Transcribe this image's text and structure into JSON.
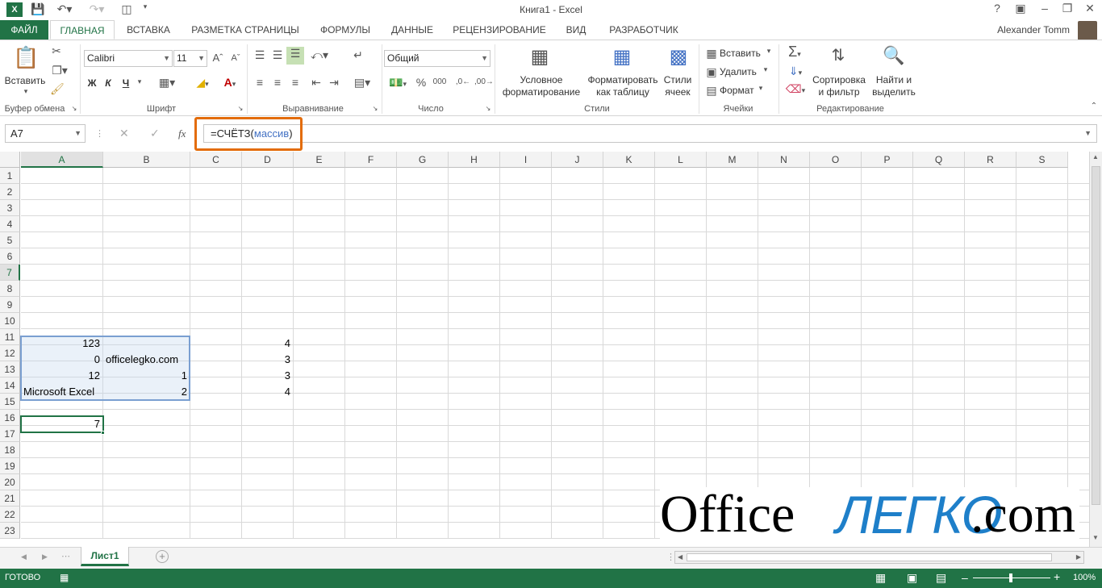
{
  "window": {
    "title": "Книга1 - Excel",
    "user": "Alexander Tomm"
  },
  "tabs": [
    {
      "label": "ФАЙЛ"
    },
    {
      "label": "ГЛАВНАЯ"
    },
    {
      "label": "ВСТАВКА"
    },
    {
      "label": "РАЗМЕТКА СТРАНИЦЫ"
    },
    {
      "label": "ФОРМУЛЫ"
    },
    {
      "label": "ДАННЫЕ"
    },
    {
      "label": "РЕЦЕНЗИРОВАНИЕ"
    },
    {
      "label": "ВИД"
    },
    {
      "label": "РАЗРАБОТЧИК"
    }
  ],
  "ribbon": {
    "paste": "Вставить",
    "font_name": "Calibri",
    "font_size": "11",
    "number_format": "Общий",
    "conditional_1": "Условное",
    "conditional_2": "форматирование",
    "format_table_1": "Форматировать",
    "format_table_2": "как таблицу",
    "cell_styles_1": "Стили",
    "cell_styles_2": "ячеек",
    "insert": "Вставить",
    "delete": "Удалить",
    "format": "Формат",
    "sort_1": "Сортировка",
    "sort_2": "и фильтр",
    "find_1": "Найти и",
    "find_2": "выделить",
    "bold": "Ж",
    "italic": "К",
    "underline": "Ч",
    "groups": {
      "clipboard": "Буфер обмена",
      "font": "Шрифт",
      "alignment": "Выравнивание",
      "number": "Число",
      "styles": "Стили",
      "cells": "Ячейки",
      "editing": "Редактирование"
    }
  },
  "formula_bar": {
    "name_box": "A7",
    "fx": "fx",
    "formula_prefix": "=СЧЁТЗ(",
    "formula_arg": "массив",
    "formula_suffix": ")"
  },
  "columns": [
    "A",
    "B",
    "C",
    "D",
    "E",
    "F",
    "G",
    "H",
    "I",
    "J",
    "K",
    "L",
    "M",
    "N",
    "O",
    "P",
    "Q",
    "R",
    "S"
  ],
  "rows": [
    "1",
    "2",
    "3",
    "4",
    "5",
    "6",
    "7",
    "8",
    "9",
    "10",
    "11",
    "12",
    "13",
    "14",
    "15",
    "16",
    "17",
    "18",
    "19",
    "20",
    "21",
    "22",
    "23"
  ],
  "cells": {
    "A2": "123",
    "A3": "0",
    "A4": "12",
    "A5": "Microsoft Excel",
    "A7": "7",
    "B3": "officelegko.com",
    "B4": "1",
    "B5": "2",
    "D2": "4",
    "D3": "3",
    "D4": "3",
    "D5": "4"
  },
  "sheet": {
    "tab": "Лист1"
  },
  "status": {
    "ready": "ГОТОВО",
    "zoom": "100%"
  },
  "watermark": {
    "part1": "Office",
    "part2": "ЛЕГКО",
    "part3": ".com"
  }
}
